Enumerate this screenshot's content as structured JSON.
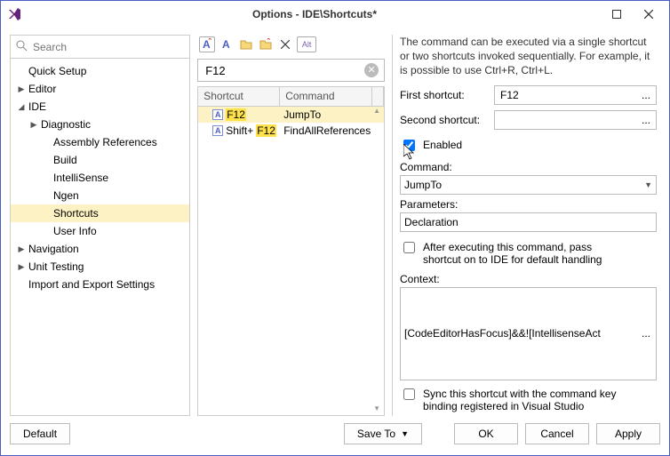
{
  "window": {
    "title": "Options - IDE\\Shortcuts*"
  },
  "search": {
    "placeholder": "Search"
  },
  "tree": [
    {
      "label": "Quick Setup",
      "indent": 0,
      "arrow": ""
    },
    {
      "label": "Editor",
      "indent": 0,
      "arrow": "▶"
    },
    {
      "label": "IDE",
      "indent": 0,
      "arrow": "◢"
    },
    {
      "label": "Diagnostic",
      "indent": 1,
      "arrow": "▶"
    },
    {
      "label": "Assembly References",
      "indent": 2,
      "arrow": ""
    },
    {
      "label": "Build",
      "indent": 2,
      "arrow": ""
    },
    {
      "label": "IntelliSense",
      "indent": 2,
      "arrow": ""
    },
    {
      "label": "Ngen",
      "indent": 2,
      "arrow": ""
    },
    {
      "label": "Shortcuts",
      "indent": 2,
      "arrow": "",
      "selected": true
    },
    {
      "label": "User Info",
      "indent": 2,
      "arrow": ""
    },
    {
      "label": "Navigation",
      "indent": 0,
      "arrow": "▶"
    },
    {
      "label": "Unit Testing",
      "indent": 0,
      "arrow": "▶"
    },
    {
      "label": "Import and Export Settings",
      "indent": 0,
      "arrow": ""
    }
  ],
  "toolbar_icons": [
    "shortcut-icon-1",
    "shortcut-icon-2",
    "folder-icon",
    "folder-open-icon",
    "delete-icon",
    "alt-icon"
  ],
  "filter": {
    "value": "F12"
  },
  "grid": {
    "headers": {
      "shortcut": "Shortcut",
      "command": "Command"
    },
    "rows": [
      {
        "prefix": "",
        "key": "F12",
        "command": "JumpTo",
        "selected": true
      },
      {
        "prefix": "Shift+",
        "key": "F12",
        "command": "FindAllReferences",
        "selected": false
      }
    ]
  },
  "right": {
    "desc": "The command can be executed via a single shortcut or two shortcuts invoked sequentially. For example, it is possible to use Ctrl+R, Ctrl+L.",
    "first_label": "First shortcut:",
    "first_value": "F12",
    "second_label": "Second shortcut:",
    "second_value": "",
    "enabled_label": "Enabled",
    "enabled_checked": true,
    "command_label": "Command:",
    "command_value": "JumpTo",
    "params_label": "Parameters:",
    "params_value": "Declaration",
    "pass_label": "After executing this command, pass shortcut on to IDE for default handling",
    "pass_checked": false,
    "context_label": "Context:",
    "context_value": "[CodeEditorHasFocus]&&![IntellisenseAct",
    "sync_label": "Sync this shortcut with the command key binding registered in Visual Studio",
    "sync_checked": false
  },
  "footer": {
    "default": "Default",
    "save_to": "Save To",
    "ok": "OK",
    "cancel": "Cancel",
    "apply": "Apply"
  }
}
